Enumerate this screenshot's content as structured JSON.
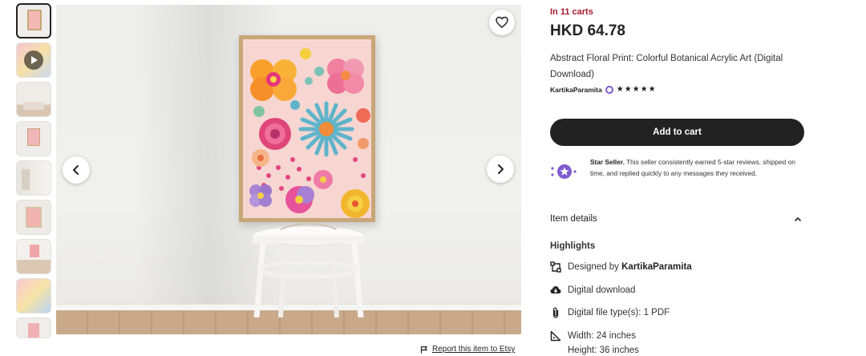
{
  "listing": {
    "in_carts": "In 11 carts",
    "price": "HKD 64.78",
    "title": "Abstract Floral Print: Colorful Botanical Acrylic Art (Digital Download)",
    "seller": "KartikaParamita",
    "rating": 5,
    "stars": "★★★★★",
    "add_to_cart": "Add to cart",
    "star_seller_title": "Star Seller.",
    "star_seller_text": "This seller consistently earned 5-star reviews, shipped on time, and replied quickly to any messages they received.",
    "item_details": "Item details",
    "highlights": "Highlights",
    "designed_by_prefix": "Designed by ",
    "designed_by_name": "KartikaParamita",
    "digital_download": "Digital download",
    "file_types": "Digital file type(s): 1 PDF",
    "width": "Width: 24 inches",
    "height": "Height: 36 inches"
  },
  "gallery": {
    "report_link": "Report this item to Etsy",
    "thumbnail_count": 9
  },
  "icons": {
    "favorite": "heart-icon",
    "prev": "chevron-left-icon",
    "next": "chevron-right-icon",
    "video": "play-icon",
    "report": "flag-icon",
    "collapse": "chevron-up-icon"
  },
  "colors": {
    "accent_red": "#a61a2e",
    "button_dark": "#222222",
    "star_seller_purple": "#7f5ccf"
  }
}
